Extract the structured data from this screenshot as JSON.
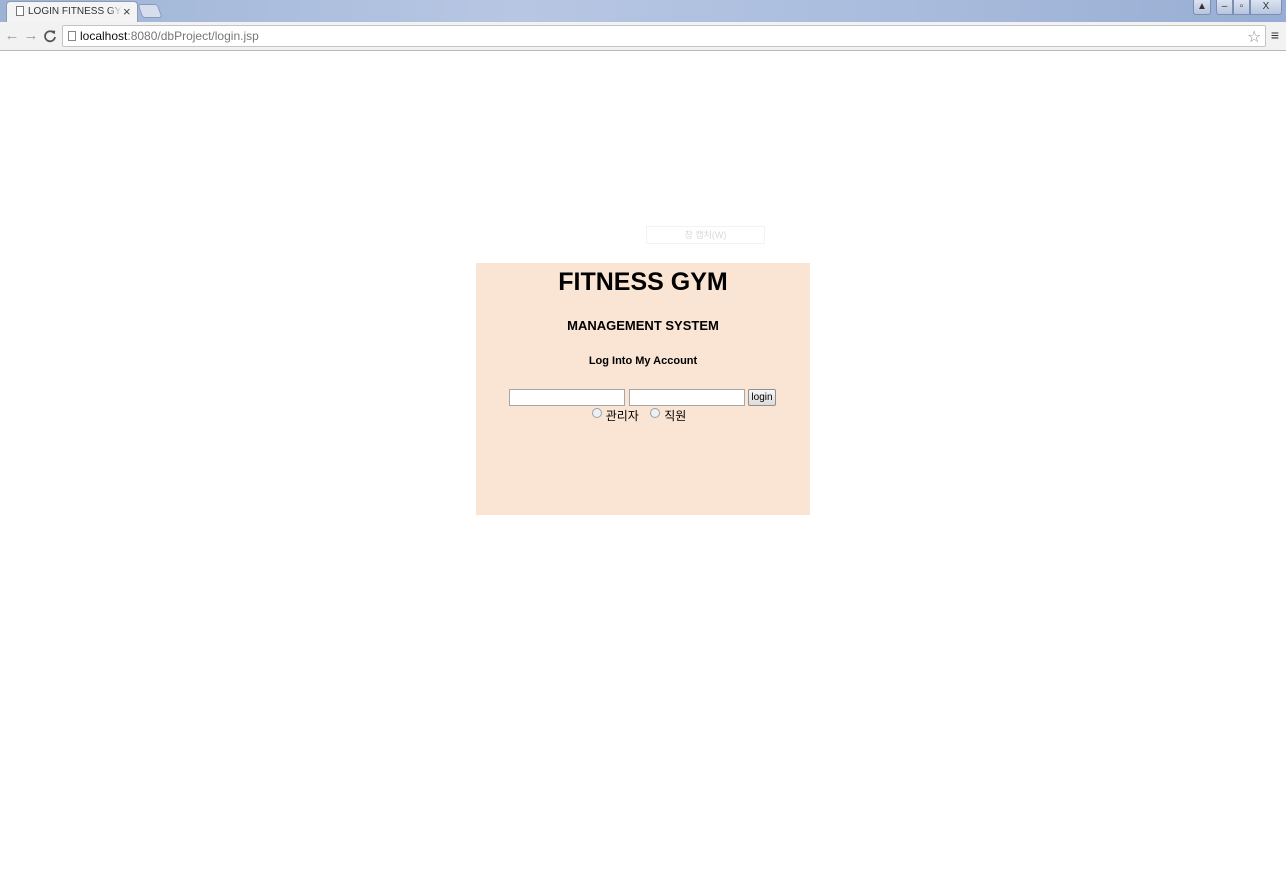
{
  "browser": {
    "tab_title": "LOGIN FITNESS GYM SYSTEM",
    "tab_close": "×",
    "url_host": "localhost",
    "url_rest": ":8080/dbProject/login.jsp",
    "nav": {
      "back": "←",
      "forward": "→",
      "reload": "C"
    },
    "star": "☆",
    "menu": "≡",
    "window": {
      "user": "▲",
      "minimize": "–",
      "maximize": "▫",
      "close": "X"
    }
  },
  "overlay": {
    "capture_hint": "창 캡처(W)"
  },
  "login": {
    "title": "FITNESS GYM",
    "subtitle": "MANAGEMENT SYSTEM",
    "heading": "Log Into My Account",
    "id_value": "",
    "pw_value": "",
    "button": "login",
    "roles": [
      {
        "label": "관리자",
        "selected": false
      },
      {
        "label": "직원",
        "selected": false
      }
    ],
    "panel_color": "#fae5d5"
  }
}
